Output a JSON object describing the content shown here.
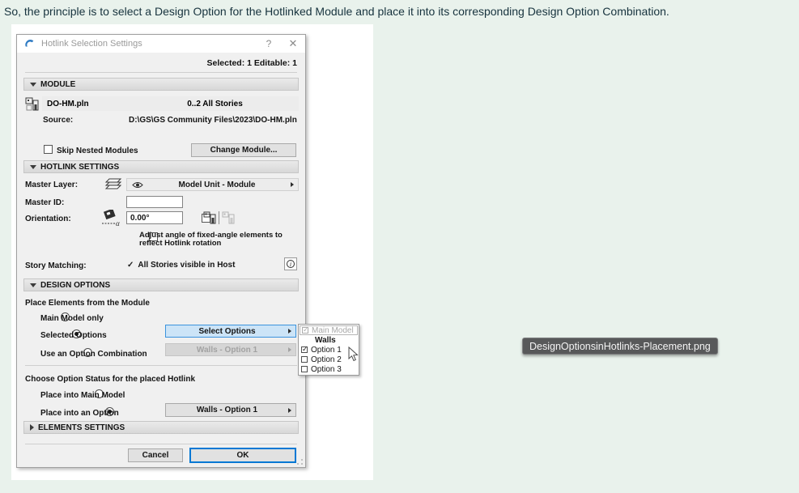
{
  "page": {
    "caption": "So, the principle is to select a Design Option for the Hotlinked Module and place it into its corresponding Design Option Combination.",
    "tooltip_label": "DesignOptionsinHotlinks-Placement.png"
  },
  "colors": {
    "page_bg": "#e9f2ec",
    "caption_text": "#17333e",
    "dialog_bg": "#f0f0f0",
    "accent_blue": "#0078d4",
    "select_highlight_bg": "#cce4f7",
    "tooltip_bg": "#58595a",
    "logo_blue": "#2f7bc3"
  },
  "dialog": {
    "title": "Hotlink Selection Settings",
    "help_button": "?",
    "close_button": "✕",
    "status": "Selected: 1 Editable: 1",
    "module": {
      "header": "MODULE",
      "file_name": "DO-HM.pln",
      "stories": "0..2 All Stories",
      "source_label": "Source:",
      "source_path": "D:\\GS\\GS Community Files\\2023\\DO-HM.pln",
      "skip_nested_label": "Skip Nested Modules",
      "change_module_button": "Change Module..."
    },
    "hotlink_settings": {
      "header": "HOTLINK SETTINGS",
      "master_layer_label": "Master Layer:",
      "master_layer_value": "Model Unit - Module",
      "master_id_label": "Master ID:",
      "master_id_value": "",
      "orientation_label": "Orientation:",
      "orientation_value": "0.00°",
      "adjust_angle_label": "Adjust angle of fixed-angle elements to reflect Hotlink rotation",
      "story_matching_label": "Story Matching:",
      "story_matching_value": "All Stories visible in Host"
    },
    "design_options": {
      "header": "DESIGN OPTIONS",
      "place_elements_label": "Place Elements from the Module",
      "radio_main_model": "Main Model only",
      "radio_selected_options": "Selected Options",
      "select_options_button": "Select Options",
      "radio_option_combination": "Use an Option Combination",
      "combination_value": "Walls - Option 1",
      "choose_status_label": "Choose Option Status for the placed Hotlink",
      "radio_place_main_model": "Place into Main Model",
      "radio_place_option": "Place into an Option",
      "place_option_value": "Walls - Option 1"
    },
    "elements_settings": {
      "header": "ELEMENTS SETTINGS"
    },
    "footer": {
      "cancel_button": "Cancel",
      "ok_button": "OK"
    }
  },
  "popup": {
    "items": [
      {
        "label": "Main Model",
        "checked": true,
        "disabled": true
      },
      {
        "label": "Walls",
        "header": true
      },
      {
        "label": "Option 1",
        "checked": true
      },
      {
        "label": "Option 2",
        "checked": false
      },
      {
        "label": "Option 3",
        "checked": false
      }
    ]
  }
}
